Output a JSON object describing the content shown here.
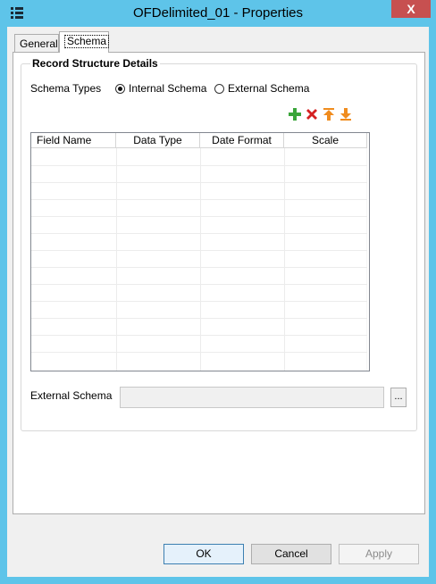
{
  "window": {
    "title": "OFDelimited_01 - Properties",
    "close_label": "X"
  },
  "tabs": [
    {
      "label": "General"
    },
    {
      "label": "Schema"
    }
  ],
  "group": {
    "title": "Record Structure Details"
  },
  "schema_types": {
    "label": "Schema Types",
    "options": [
      {
        "label": "Internal Schema",
        "selected": true
      },
      {
        "label": "External Schema",
        "selected": false
      }
    ]
  },
  "toolbar": {
    "icons": [
      "add-icon",
      "delete-icon",
      "move-up-icon",
      "move-down-icon"
    ]
  },
  "grid": {
    "columns": [
      "Field Name",
      "Data Type",
      "Date Format",
      "Scale"
    ],
    "rows": []
  },
  "external_schema": {
    "label": "External Schema",
    "value": "",
    "browse_label": "..."
  },
  "buttons": {
    "ok": "OK",
    "cancel": "Cancel",
    "apply": "Apply"
  },
  "colors": {
    "titlebar": "#5ec4e9",
    "close": "#c75050",
    "add": "#3aa53a",
    "delete": "#d42020",
    "arrows": "#f08c1e"
  }
}
